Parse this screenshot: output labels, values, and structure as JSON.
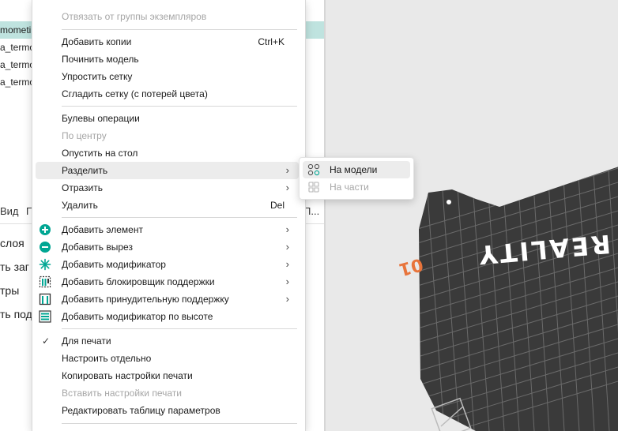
{
  "colors": {
    "accent": "#00a693",
    "selection": "#bfe3df",
    "bed": "#3a3a3a",
    "bed_logo": "#ffffff",
    "plate_label": "#e8743b",
    "viewport_bg": "#e9e9e9"
  },
  "left_panel": {
    "objects": [
      {
        "text": "mometi",
        "selected": true
      },
      {
        "text": "a_termo",
        "selected": false
      },
      {
        "text": "a_termo",
        "selected": false
      },
      {
        "text": "a_termo",
        "selected": false
      }
    ],
    "tabs": {
      "view": "Вид",
      "partial_p": "П",
      "right_partial": "П..."
    },
    "settings": [
      "слоя",
      "ть заг",
      "тры",
      "ть под"
    ]
  },
  "context_menu": {
    "items": [
      {
        "label": "Отвязать от группы экземпляров",
        "disabled": true
      },
      {
        "label": "Добавить копии",
        "shortcut": "Ctrl+K"
      },
      {
        "label": "Починить модель"
      },
      {
        "label": "Упростить сетку"
      },
      {
        "label": "Сгладить сетку (с потерей цвета)"
      },
      {
        "label": "Булевы операции"
      },
      {
        "label": "По центру",
        "disabled": true
      },
      {
        "label": "Опустить на стол"
      },
      {
        "label": "Разделить",
        "submenu": true,
        "highlighted": true
      },
      {
        "label": "Отразить",
        "submenu": true
      },
      {
        "label": "Удалить",
        "shortcut": "Del"
      },
      {
        "label": "Добавить элемент",
        "submenu": true,
        "icon": "add-part-icon"
      },
      {
        "label": "Добавить вырез",
        "submenu": true,
        "icon": "add-negative-part-icon"
      },
      {
        "label": "Добавить модификатор",
        "submenu": true,
        "icon": "add-modifier-icon"
      },
      {
        "label": "Добавить блокировщик поддержки",
        "submenu": true,
        "icon": "support-blocker-icon"
      },
      {
        "label": "Добавить принудительную поддержку",
        "submenu": true,
        "icon": "support-enforcer-icon"
      },
      {
        "label": "Добавить модификатор по высоте",
        "icon": "height-range-modifier-icon"
      },
      {
        "label": "Для печати",
        "checked": true
      },
      {
        "label": "Настроить отдельно"
      },
      {
        "label": "Копировать настройки печати"
      },
      {
        "label": "Вставить настройки печати",
        "disabled": true
      },
      {
        "label": "Редактировать таблицу параметров"
      }
    ],
    "arrow_glyph": "›",
    "check_glyph": "✓"
  },
  "submenu": {
    "items": [
      {
        "label": "На модели",
        "icon": "split-to-objects-icon",
        "highlighted": true
      },
      {
        "label": "На части",
        "icon": "split-to-parts-icon",
        "disabled": true
      }
    ]
  },
  "viewport": {
    "plate_label": "01",
    "bed_logo": "REALITY"
  }
}
